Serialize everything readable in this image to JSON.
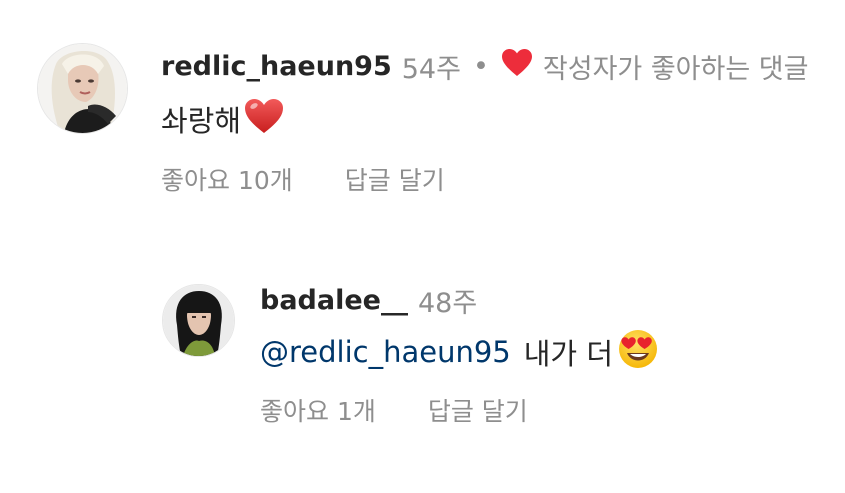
{
  "comment": {
    "username": "redlic_haeun95",
    "time": "54주",
    "separator": "•",
    "liked_by_author_text": "작성자가 좋아하는 댓글",
    "text": "솨랑해",
    "emoji": "red-heart",
    "likes_label": "좋아요 10개",
    "reply_label": "답글 달기"
  },
  "reply": {
    "username": "badalee__",
    "time": "48주",
    "mention": "@redlic_haeun95",
    "text": "내가 더",
    "emoji": "heart-eyes-face",
    "likes_label": "좋아요 1개",
    "reply_label": "답글 달기"
  },
  "colors": {
    "text_primary": "#262626",
    "text_muted": "#8e8e8e",
    "mention": "#00376b",
    "heart_red": "#ed4956",
    "background": "#ffffff"
  }
}
